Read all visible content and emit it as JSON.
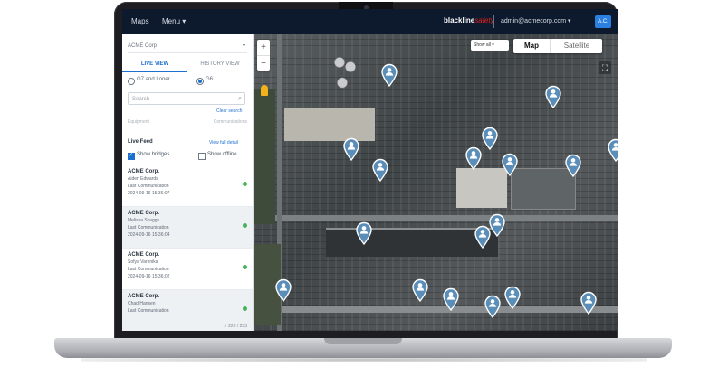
{
  "topbar": {
    "nav_maps": "Maps",
    "nav_menu": "Menu ▾",
    "brand_main": "blackline",
    "brand_accent": "safety",
    "user_email": "admin@acmecorp.com ▾",
    "user_initials": "A.C."
  },
  "sidebar": {
    "org": "ACME Corp",
    "tabs": [
      "LIVE VIEW",
      "HISTORY VIEW"
    ],
    "active_tab": 0,
    "radio_options": [
      "G7 and Loner",
      "G6"
    ],
    "radio_selected": 1,
    "search_placeholder": "Search",
    "clear_label": "Clear search",
    "faint_left": "Equipment",
    "faint_right": "Communications",
    "live_feed_title": "Live Feed",
    "view_all_label": "View full detail",
    "show_bridges": "Show bridges",
    "show_offline": "Show offline",
    "feed_items": [
      {
        "org": "ACME Corp.",
        "name": "Aiden Edwards",
        "label": "Last Communication",
        "time": "2024-09-16 15:36:07"
      },
      {
        "org": "ACME Corp.",
        "name": "Melissa Skaggs",
        "label": "Last Communication",
        "time": "2024-09-16 15:36:04"
      },
      {
        "org": "ACME Corp.",
        "name": "Sofya Varenika",
        "label": "Last Communication",
        "time": "2024-09-16 15:36:02"
      },
      {
        "org": "ACME Corp.",
        "name": "Chad Hansen",
        "label": "Last Communication",
        "time": ""
      }
    ],
    "pager": "⇩ 229 / 253"
  },
  "map": {
    "layer_select": "Show all ▾",
    "maptype_map": "Map",
    "maptype_satellite": "Satellite",
    "zoom_in": "+",
    "zoom_out": "−",
    "fullscreen_icon": "⛶",
    "pin_color": "#5a8db7",
    "pin_count": 17
  }
}
